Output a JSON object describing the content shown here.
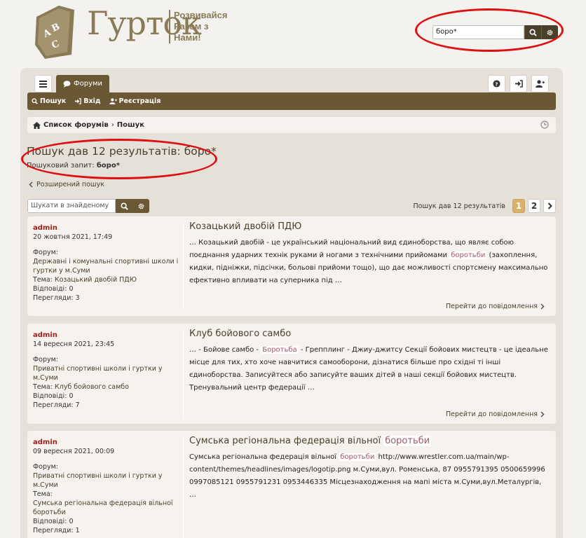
{
  "header": {
    "logo_name": "Гурток",
    "logo_tag": [
      "Розвивайся",
      "Разом з",
      "Нами!"
    ],
    "logo_letters": [
      "А",
      "В",
      "С"
    ],
    "search_value": "боро*"
  },
  "tabs": {
    "forums": "Форуми"
  },
  "navbar": {
    "search": "Пошук",
    "login": "Вхід",
    "register": "Реєстрація"
  },
  "breadcrumb": {
    "home": "Список форумів",
    "sep": "›",
    "current": "Пошук"
  },
  "page": {
    "title": "Пошук дав 12 результатів: боро*",
    "query_label": "Пошуковий запит:",
    "query_value": "боро*",
    "advanced": "Розширений пошук",
    "within_placeholder": "Шукати в знайденому",
    "results_count": "Пошук дав 12 результатів",
    "pages": [
      "1",
      "2"
    ]
  },
  "labels": {
    "forum": "Форум:",
    "topic": "Тема:",
    "replies": "Відповіді:",
    "views": "Перегляди:",
    "goto": "Перейти до повідомлення"
  },
  "posts": [
    {
      "author": "admin",
      "date": "20 жовтня 2021, 17:49",
      "forum": "Державні і комунальні спортивні школи і гуртки у м.Суми",
      "topic": "Козацький двобій ПДЮ",
      "replies": "0",
      "views": "3",
      "title": "Козацький двобій ПДЮ",
      "text_a": "… Козацький двобій - це український національний вид єдиноборства, що являє собою поєднання ударних технік руками й ногами з технічними прийомами ",
      "hl": "боротьби",
      "text_b": " (захоплення, кидки, підніжки, підсічки, больові прийоми тощо), що дає можливості спортсмену максимально ефективно впливати на суперника під …"
    },
    {
      "author": "admin",
      "date": "14 вересня 2021, 23:45",
      "forum": "Приватні спортивні школи і гуртки у м.Суми",
      "topic": "Клуб бойового самбо",
      "replies": "0",
      "views": "7",
      "title": "Клуб бойового самбо",
      "text_a": "… - Бойове самбо - ",
      "hl": "Боротьба",
      "text_b": " - Грепплинг - Джиу-джитсу Секції бойових мистецтв - це ідеальне місце для тих, хто хоче навчитися самооборони, дізнатися більше про східні ті інші єдиноборства. Записуйтеся або записуйте ваших дітей в наші секції бойових мистецтв. Тренувальний центр федерації …"
    },
    {
      "author": "admin",
      "date": "09 вересня 2021, 00:09",
      "forum": "Приватні спортивні школи і гуртки у м.Суми",
      "topic": "Сумська регіональна федерація вільної боротьби",
      "replies": "0",
      "views": "1",
      "title_a": "Сумська регіональна федерація вільної ",
      "title_hl": "боротьби",
      "text_a": "Сумська регіональна федерація вільної ",
      "hl": "боротьби",
      "text_b": " http://www.wrestler.com.ua/main/wp-content/themes/headlines/images/logotip.png м.Суми,вул. Роменська, 87 0955791395 0500659996 0997085121 0955791231 0953446335 Місцезнаходження на мапі міста м.Суми,вул.Металургів, …"
    }
  ]
}
